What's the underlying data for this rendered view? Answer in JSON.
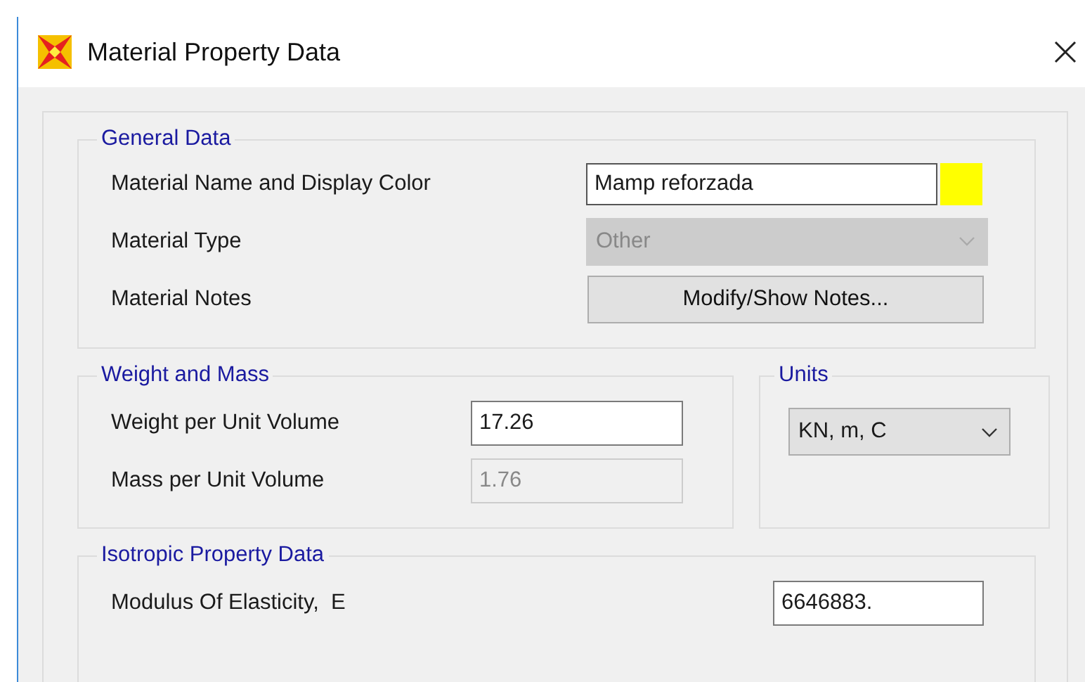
{
  "window": {
    "title": "Material Property Data"
  },
  "general_data": {
    "legend": "General Data",
    "rows": [
      {
        "kind": "text",
        "label": "Material Name and Display Color",
        "value": "Mamp reforzada",
        "color": "#ffff00"
      },
      {
        "kind": "dropdown",
        "label": "Material Type",
        "value": "Other",
        "disabled": true
      },
      {
        "kind": "button",
        "label": "Material Notes",
        "value": "Modify/Show Notes..."
      }
    ]
  },
  "weight_and_mass": {
    "legend": "Weight and Mass",
    "rows": [
      {
        "label": "Weight per Unit Volume",
        "value": "17.26",
        "disabled": false
      },
      {
        "label": "Mass per Unit Volume",
        "value": "1.76",
        "disabled": true
      }
    ]
  },
  "units": {
    "legend": "Units",
    "value": "KN, m, C"
  },
  "isotropic_property_data": {
    "legend": "Isotropic Property Data",
    "rows": [
      {
        "label": "Modulus Of Elasticity,  E",
        "value": "6646883."
      }
    ]
  }
}
